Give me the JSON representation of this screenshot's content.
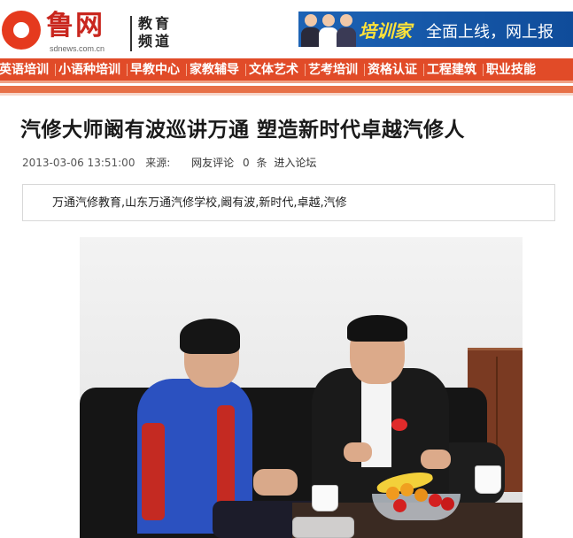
{
  "header": {
    "logo_text": "鲁网",
    "logo_url": "sdnews.com.cn",
    "channel": "教育频道",
    "banner": {
      "brand": "培训家",
      "slogan": "全面上线，网上报"
    }
  },
  "nav": {
    "items": [
      "英语培训",
      "小语种培训",
      "早教中心",
      "家教辅导",
      "文体艺术",
      "艺考培训",
      "资格认证",
      "工程建筑",
      "职业技能"
    ]
  },
  "article": {
    "title": "汽修大师阚有波巡讲万通  塑造新时代卓越汽修人",
    "date": "2013-03-06 13:51:00",
    "source_label": "来源:",
    "comment_label": "网友评论",
    "comment_count": "0",
    "comment_unit": "条",
    "forum_link": "进入论坛",
    "tags": "万通汽修教育,山东万通汽修学校,阚有波,新时代,卓越,汽修"
  },
  "colors": {
    "nav_bg": "#e14b28",
    "logo_red": "#c9261e",
    "banner_blue": "#1d63b5",
    "banner_yellow": "#ffe23a"
  }
}
